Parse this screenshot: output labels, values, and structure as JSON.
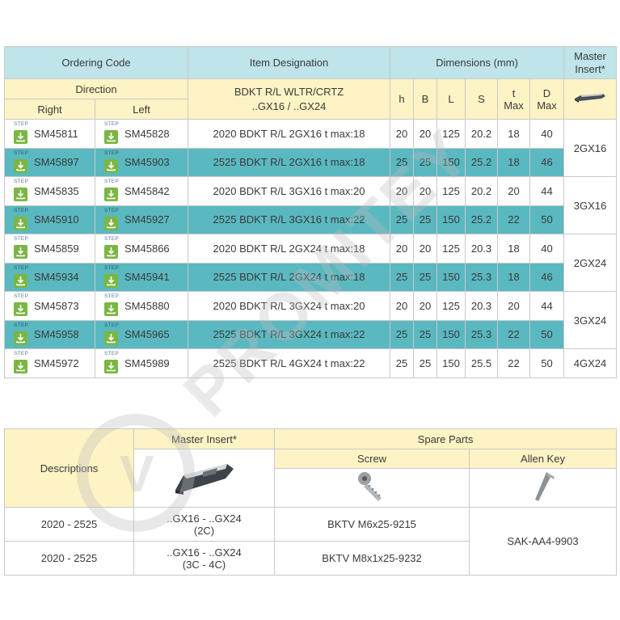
{
  "main_table": {
    "headers": {
      "ordering_code": "Ordering Code",
      "item_designation": "Item Designation",
      "dimensions": "Dimensions (mm)",
      "master_insert": "Master Insert*",
      "direction": "Direction",
      "designation_sub_1": "BDKT R/L WLTR/CRTZ",
      "designation_sub_2": "..GX16 / ..GX24",
      "right": "Right",
      "left": "Left",
      "h": "h",
      "b": "B",
      "l": "L",
      "s": "S",
      "t_max_1": "t",
      "t_max_2": "Max",
      "d_max_1": "D",
      "d_max_2": "Max"
    },
    "step_badge": "STEP",
    "rows": [
      {
        "right": "SM45811",
        "left": "SM45828",
        "designation": "2020 BDKT R/L 2GX16 t max:18",
        "h": "20",
        "b": "20",
        "l": "125",
        "s": "20.2",
        "t": "18",
        "d": "40"
      },
      {
        "right": "SM45897",
        "left": "SM45903",
        "designation": "2525 BDKT R/L 2GX16 t max:18",
        "h": "25",
        "b": "25",
        "l": "150",
        "s": "25.2",
        "t": "18",
        "d": "46"
      },
      {
        "right": "SM45835",
        "left": "SM45842",
        "designation": "2020 BDKT R/L 3GX16 t max:20",
        "h": "20",
        "b": "20",
        "l": "125",
        "s": "20.2",
        "t": "20",
        "d": "44"
      },
      {
        "right": "SM45910",
        "left": "SM45927",
        "designation": "2525 BDKT R/L 3GX16 t max:22",
        "h": "25",
        "b": "25",
        "l": "150",
        "s": "25.2",
        "t": "22",
        "d": "50"
      },
      {
        "right": "SM45859",
        "left": "SM45866",
        "designation": "2020 BDKT R/L 2GX24 t max:18",
        "h": "20",
        "b": "20",
        "l": "125",
        "s": "20.3",
        "t": "18",
        "d": "40"
      },
      {
        "right": "SM45934",
        "left": "SM45941",
        "designation": "2525 BDKT R/L 2GX24 t max:18",
        "h": "25",
        "b": "25",
        "l": "150",
        "s": "25.3",
        "t": "18",
        "d": "46"
      },
      {
        "right": "SM45873",
        "left": "SM45880",
        "designation": "2020 BDKT R/L 3GX24 t max:20",
        "h": "20",
        "b": "20",
        "l": "125",
        "s": "20.3",
        "t": "20",
        "d": "44"
      },
      {
        "right": "SM45958",
        "left": "SM45965",
        "designation": "2525 BDKT R/L 3GX24 t max:22",
        "h": "25",
        "b": "25",
        "l": "150",
        "s": "25.3",
        "t": "22",
        "d": "50"
      },
      {
        "right": "SM45972",
        "left": "SM45989",
        "designation": "2525 BDKT R/L 4GX24 t max:22",
        "h": "25",
        "b": "25",
        "l": "150",
        "s": "25.5",
        "t": "22",
        "d": "50"
      }
    ],
    "insert_groups": [
      "2GX16",
      "3GX16",
      "2GX24",
      "3GX24",
      "4GX24"
    ]
  },
  "parts_table": {
    "descriptions": "Descriptions",
    "master_insert": "Master Insert*",
    "spare_parts": "Spare Parts",
    "screw": "Screw",
    "allen_key": "Allen Key",
    "rows": [
      {
        "desc": "2020 - 2525",
        "insert_1": "..GX16 - ..GX24",
        "insert_2": "(2C)",
        "screw": "BKTV M6x25-9215"
      },
      {
        "desc": "2020 - 2525",
        "insert_1": "..GX16 - ..GX24",
        "insert_2": "(3C - 4C)",
        "screw": "BKTV M8x1x25-9232"
      }
    ],
    "allen_key_value": "SAK-AA4-9903"
  },
  "watermark": "PROMITEY",
  "colors": {
    "header_blue": "#bfe4ea",
    "header_yellow": "#fdf3c4",
    "row_teal": "#5ab8c0",
    "download_green": "#7ab642"
  },
  "icons": [
    "download-icon",
    "insert-icon",
    "screw-icon",
    "allen-key-icon"
  ]
}
